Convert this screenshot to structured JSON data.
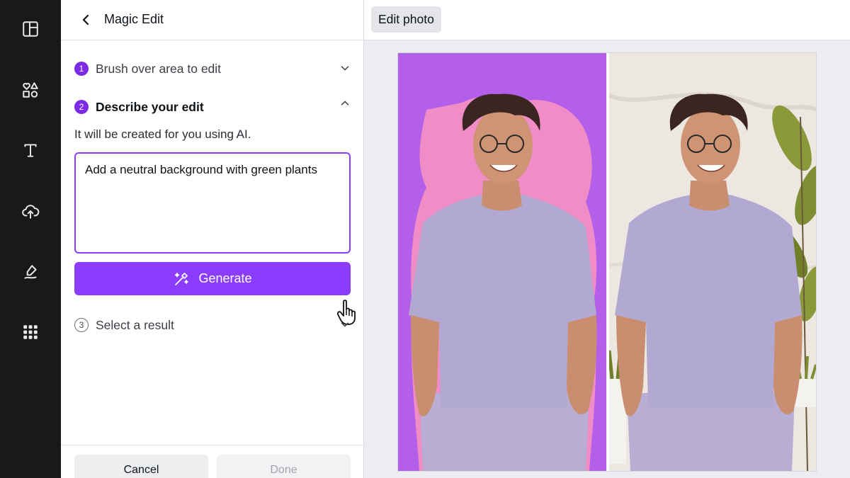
{
  "rail": {
    "items": [
      "layout",
      "elements",
      "text",
      "uploads",
      "draw",
      "apps"
    ]
  },
  "panel": {
    "title": "Magic Edit",
    "steps": [
      {
        "number": "1",
        "label": "Brush over area to edit"
      },
      {
        "number": "2",
        "label": "Describe your edit"
      },
      {
        "number": "3",
        "label": "Select a result"
      }
    ],
    "helper": "It will be created for you using AI.",
    "prompt_value": "Add a neutral background with green plants",
    "generate_label": "Generate",
    "cancel_label": "Cancel",
    "done_label": "Done"
  },
  "topbar": {
    "edit_photo_label": "Edit photo"
  },
  "colors": {
    "accent": "#8b3dff",
    "step_badge": "#7d2ae8",
    "rail_bg": "#18191b",
    "before_bg": "#b45fea",
    "after_bg": "#ece7e0"
  }
}
